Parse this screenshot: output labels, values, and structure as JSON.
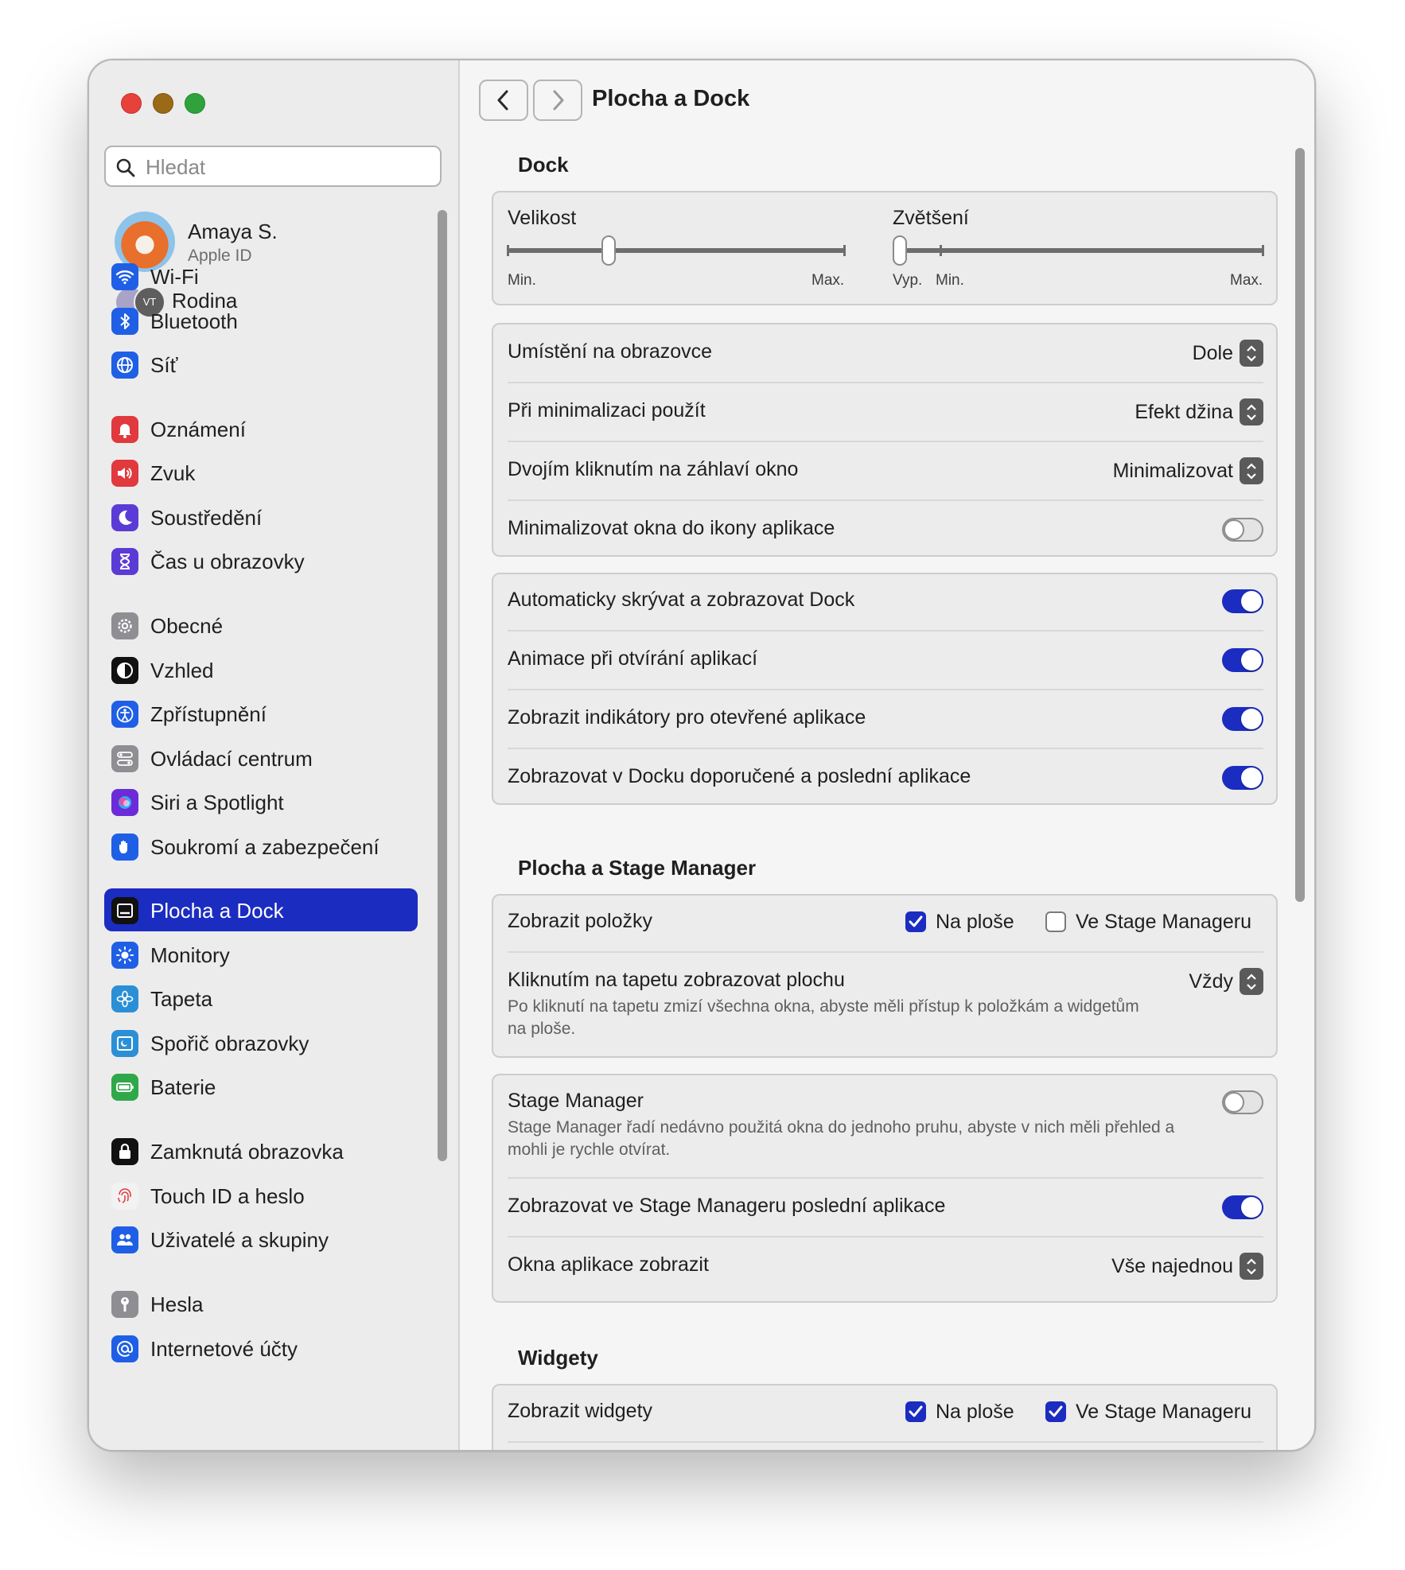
{
  "window": {
    "title": "Plocha a Dock"
  },
  "sidebar": {
    "search_placeholder": "Hledat",
    "profile": {
      "name": "Amaya S.",
      "subtitle": "Apple ID"
    },
    "family": {
      "badge": "VT",
      "label": "Rodina"
    },
    "items": [
      {
        "label": "Wi-Fi",
        "icon": "wifi-icon",
        "color": "#1f5fe6"
      },
      {
        "label": "Bluetooth",
        "icon": "bluetooth-icon",
        "color": "#1f5fe6"
      },
      {
        "label": "Síť",
        "icon": "globe-icon",
        "color": "#1f5fe6"
      },
      {
        "label": "Oznámení",
        "icon": "bell-icon",
        "color": "#e0393e"
      },
      {
        "label": "Zvuk",
        "icon": "speaker-icon",
        "color": "#e0393e"
      },
      {
        "label": "Soustředění",
        "icon": "moon-icon",
        "color": "#5b3bd6"
      },
      {
        "label": "Čas u obrazovky",
        "icon": "hourglass-icon",
        "color": "#5b3bd6"
      },
      {
        "label": "Obecné",
        "icon": "gear-icon",
        "color": "#8e8e93"
      },
      {
        "label": "Vzhled",
        "icon": "appearance-icon",
        "color": "#111111"
      },
      {
        "label": "Zpřístupnění",
        "icon": "accessibility-icon",
        "color": "#1f5fe6"
      },
      {
        "label": "Ovládací centrum",
        "icon": "control-center-icon",
        "color": "#8e8e93"
      },
      {
        "label": "Siri a Spotlight",
        "icon": "siri-icon",
        "color": "#6b2bd8"
      },
      {
        "label": "Soukromí a zabezpečení",
        "icon": "hand-icon",
        "color": "#1f5fe6"
      },
      {
        "label": "Plocha a Dock",
        "icon": "dock-icon",
        "color": "#111111"
      },
      {
        "label": "Monitory",
        "icon": "brightness-icon",
        "color": "#1f5fe6"
      },
      {
        "label": "Tapeta",
        "icon": "flower-icon",
        "color": "#2b8fd6"
      },
      {
        "label": "Spořič obrazovky",
        "icon": "screensaver-icon",
        "color": "#2b8fd6"
      },
      {
        "label": "Baterie",
        "icon": "battery-icon",
        "color": "#2fa84a"
      },
      {
        "label": "Zamknutá obrazovka",
        "icon": "lock-icon",
        "color": "#111111"
      },
      {
        "label": "Touch ID a heslo",
        "icon": "fingerprint-icon",
        "color": "#f2f2f2"
      },
      {
        "label": "Uživatelé a skupiny",
        "icon": "users-icon",
        "color": "#1f5fe6"
      },
      {
        "label": "Hesla",
        "icon": "key-icon",
        "color": "#8e8e93"
      },
      {
        "label": "Internetové účty",
        "icon": "at-icon",
        "color": "#1f5fe6"
      }
    ],
    "active_index": 13
  },
  "main": {
    "title": "Plocha a Dock",
    "dock": {
      "title": "Dock",
      "size": {
        "label": "Velikost",
        "min": "Min.",
        "max": "Max.",
        "value": 0.3
      },
      "magnification": {
        "label": "Zvětšení",
        "off": "Vyp.",
        "min": "Min.",
        "max": "Max.",
        "value": 0.0
      },
      "position": {
        "label": "Umístění na obrazovce",
        "value": "Dole"
      },
      "minimize_effect": {
        "label": "Při minimalizaci použít",
        "value": "Efekt džina"
      },
      "double_click": {
        "label": "Dvojím kliknutím na záhlaví okno",
        "value": "Minimalizovat"
      },
      "minimize_to_icon": {
        "label": "Minimalizovat okna do ikony aplikace",
        "on": false
      },
      "autohide": {
        "label": "Automaticky skrývat a zobrazovat Dock",
        "on": true
      },
      "animate": {
        "label": "Animace při otvírání aplikací",
        "on": true
      },
      "indicators": {
        "label": "Zobrazit indikátory pro otevřené aplikace",
        "on": true
      },
      "recents": {
        "label": "Zobrazovat v Docku doporučené a poslední aplikace",
        "on": true
      }
    },
    "stage": {
      "title": "Plocha a Stage Manager",
      "show_items": {
        "label": "Zobrazit položky",
        "desktop": "Na ploše",
        "desktop_on": true,
        "stage": "Ve Stage Manageru",
        "stage_on": false
      },
      "click_wallpaper": {
        "label": "Kliknutím na tapetu zobrazovat plochu",
        "desc": "Po kliknutí na tapetu zmizí všechna okna, abyste měli přístup k položkám a widgetům na ploše.",
        "value": "Vždy"
      },
      "stage_manager": {
        "label": "Stage Manager",
        "desc": "Stage Manager řadí nedávno použitá okna do jednoho pruhu, abyste v nich měli přehled a mohli je rychle otvírat.",
        "on": false
      },
      "recent_apps": {
        "label": "Zobrazovat ve Stage Manageru poslední aplikace",
        "on": true
      },
      "app_windows": {
        "label": "Okna aplikace zobrazit",
        "value": "Vše najednou"
      }
    },
    "widgets": {
      "title": "Widgety",
      "show": {
        "label": "Zobrazit widgety",
        "desktop": "Na ploše",
        "desktop_on": true,
        "stage": "Ve Stage Manageru",
        "stage_on": true
      }
    }
  }
}
